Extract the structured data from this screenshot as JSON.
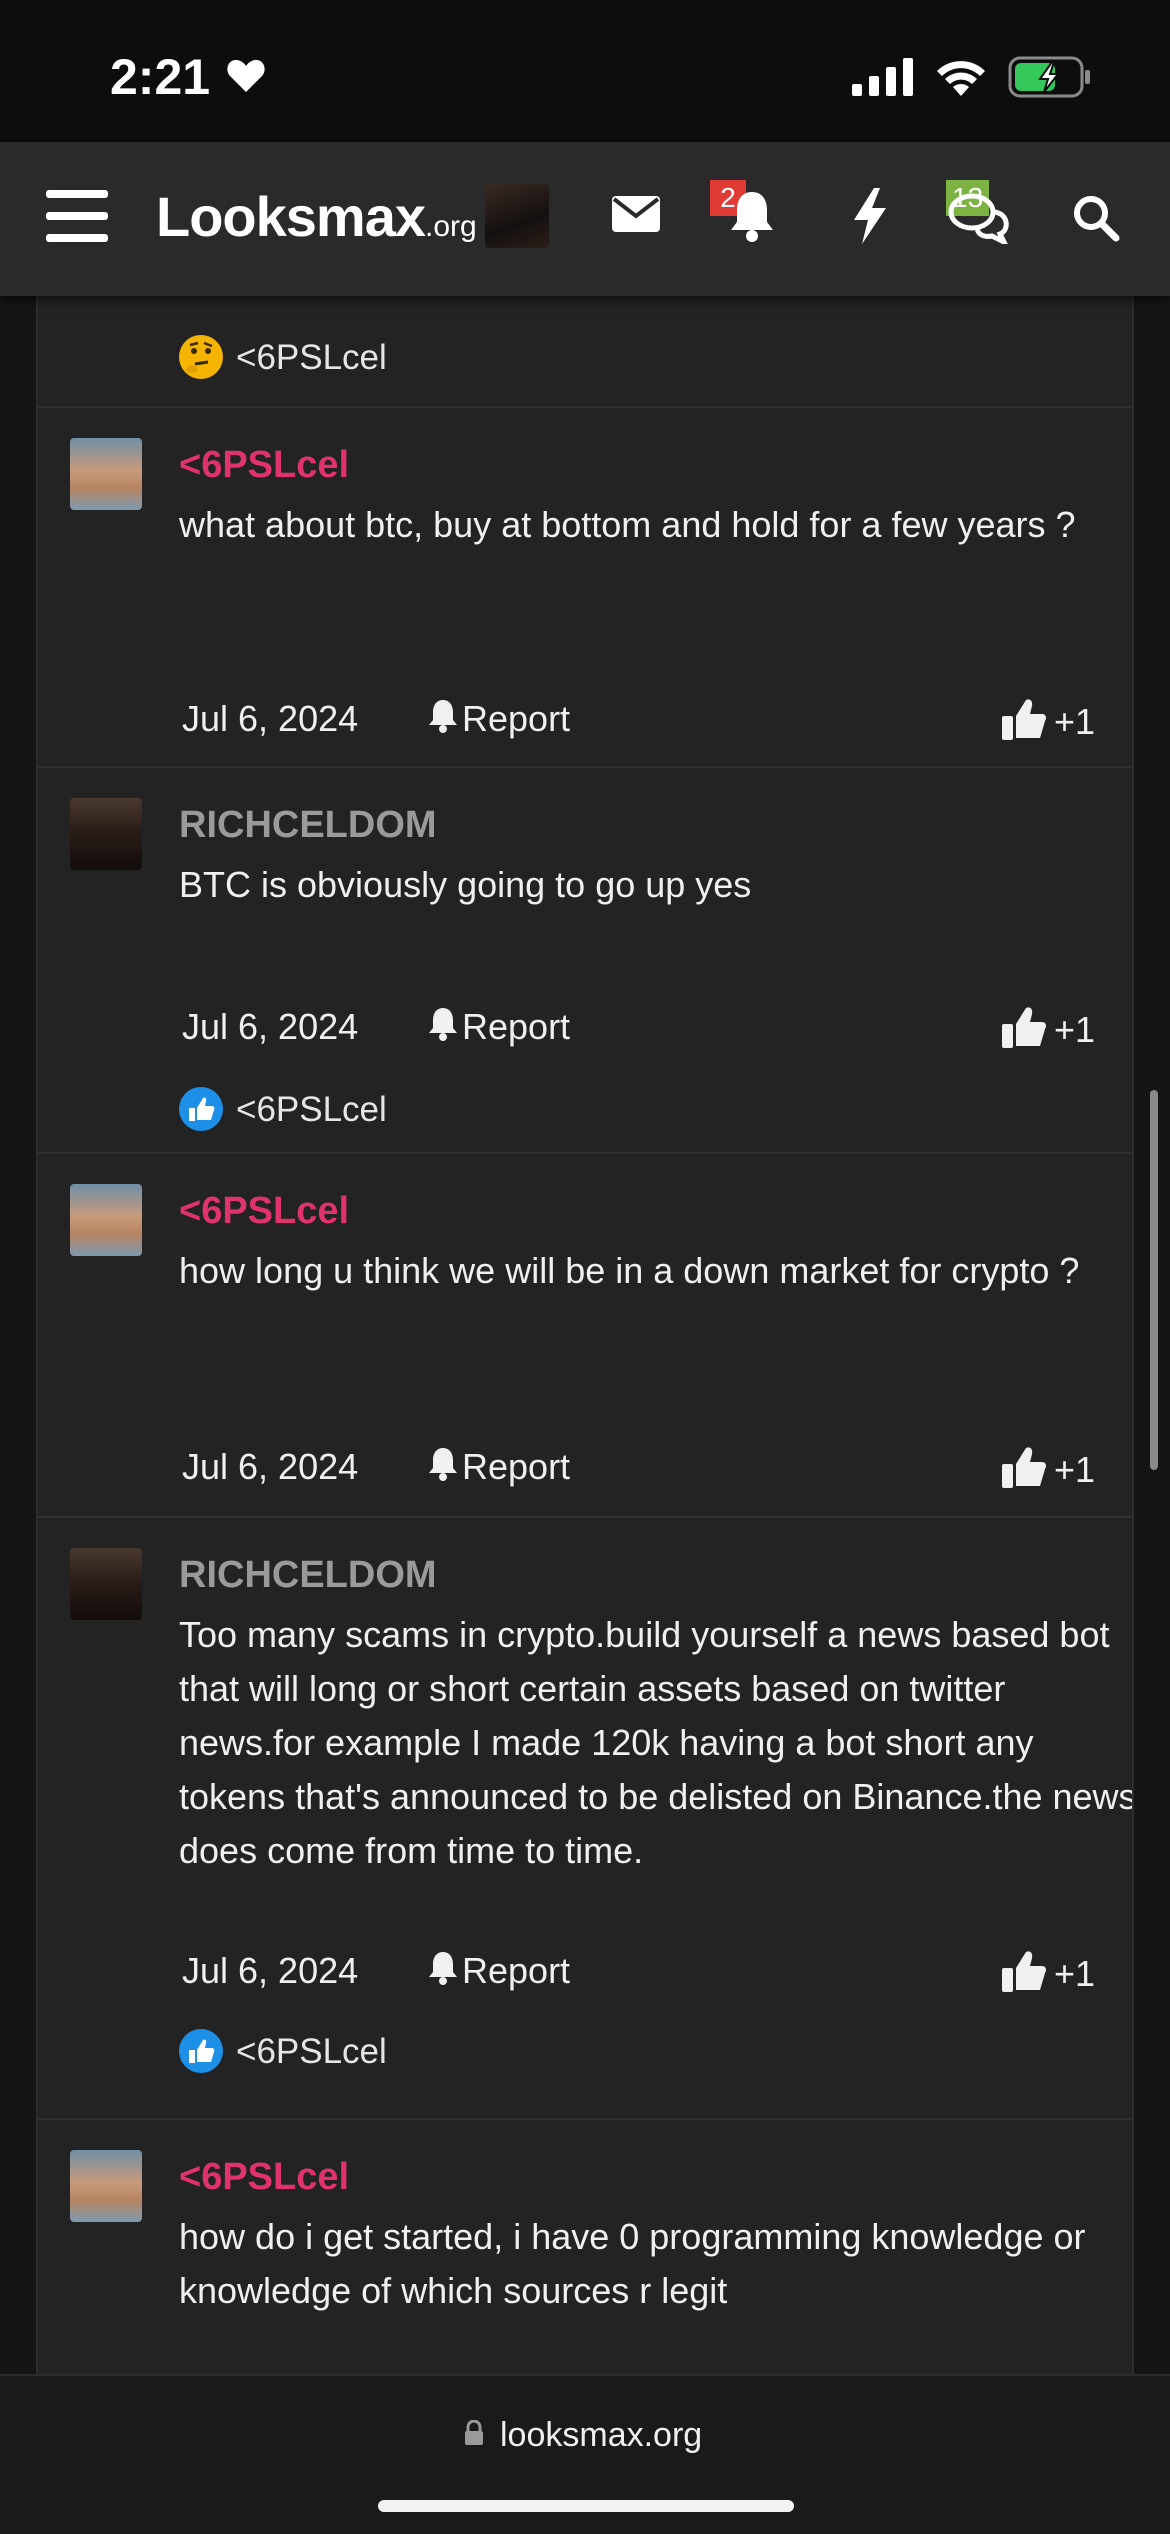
{
  "status_bar": {
    "time": "2:21"
  },
  "nav": {
    "logo_main": "Looksmax",
    "logo_suffix": ".org",
    "alerts_badge": "2",
    "conversations_badge": "13"
  },
  "thread": {
    "top_reaction": {
      "user": "<6PSLcel",
      "icon": "thinking-emoji"
    },
    "posts": [
      {
        "author": "<6PSLcel",
        "body": "what about btc, buy at bottom and hold for a few years ?",
        "date": "Jul 6, 2024",
        "report_label": "Report",
        "like_label": "+1"
      },
      {
        "author": "RICHCELDOM",
        "body": "BTC is obviously going to go up yes",
        "date": "Jul 6, 2024",
        "report_label": "Report",
        "like_label": "+1",
        "reaction_user": "<6PSLcel"
      },
      {
        "author": "<6PSLcel",
        "body": "how long u think we will be in a down market for crypto ?",
        "date": "Jul 6, 2024",
        "report_label": "Report",
        "like_label": "+1"
      },
      {
        "author": "RICHCELDOM",
        "body": "Too many scams in crypto.build yourself a news based bot that will long or short certain assets based on twitter news.for example I made 120k having a bot short any tokens that's announced to be delisted on Binance.the news does come from time to time.",
        "date": "Jul 6, 2024",
        "report_label": "Report",
        "like_label": "+1",
        "reaction_user": "<6PSLcel"
      },
      {
        "author": "<6PSLcel",
        "body": "how do i get started, i have 0 programming knowledge or knowledge of which sources r legit"
      }
    ]
  },
  "browser": {
    "url": "looksmax.org"
  },
  "colors": {
    "author_highlight": "#e0336b",
    "author_muted": "#9a9a9a",
    "alert_badge": "#e03b34",
    "convo_badge": "#7cb342",
    "like_reaction": "#1d8fe6"
  }
}
